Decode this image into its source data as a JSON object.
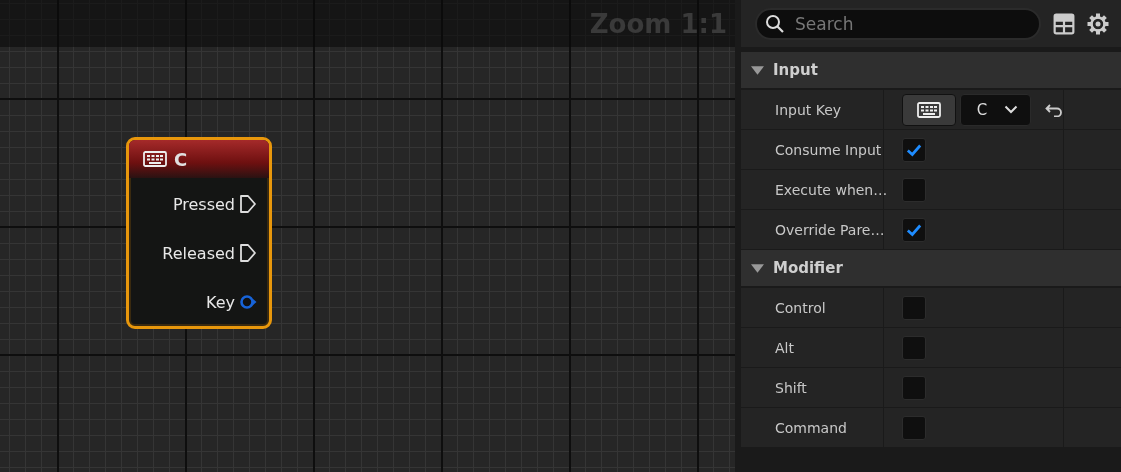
{
  "graph": {
    "zoom_label": "Zoom 1:1",
    "node": {
      "title": "C",
      "pins": [
        {
          "label": "Pressed",
          "kind": "exec"
        },
        {
          "label": "Released",
          "kind": "exec"
        },
        {
          "label": "Key",
          "kind": "data"
        }
      ]
    }
  },
  "details": {
    "search": {
      "placeholder": "Search"
    },
    "sections": [
      {
        "title": "Input",
        "expanded": true,
        "rows": [
          {
            "label": "Input Key",
            "kind": "key",
            "value": "C"
          },
          {
            "label": "Consume Input",
            "kind": "checkbox",
            "checked": true
          },
          {
            "label": "Execute when…",
            "kind": "checkbox",
            "checked": false
          },
          {
            "label": "Override Pare…",
            "kind": "checkbox",
            "checked": true
          }
        ]
      },
      {
        "title": "Modifier",
        "expanded": true,
        "rows": [
          {
            "label": "Control",
            "kind": "checkbox",
            "checked": false
          },
          {
            "label": "Alt",
            "kind": "checkbox",
            "checked": false
          },
          {
            "label": "Shift",
            "kind": "checkbox",
            "checked": false
          },
          {
            "label": "Command",
            "kind": "checkbox",
            "checked": false
          }
        ]
      }
    ]
  }
}
